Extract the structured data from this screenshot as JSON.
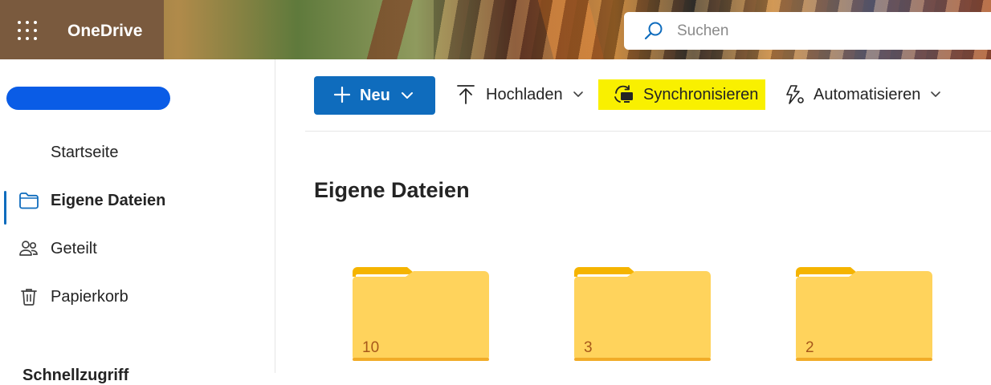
{
  "header": {
    "app_name": "OneDrive",
    "search_placeholder": "Suchen"
  },
  "sidebar": {
    "items": [
      {
        "label": "Startseite",
        "icon": "home-icon",
        "active": false
      },
      {
        "label": "Eigene Dateien",
        "icon": "folder-icon",
        "active": true
      },
      {
        "label": "Geteilt",
        "icon": "people-icon",
        "active": false
      },
      {
        "label": "Papierkorb",
        "icon": "trash-icon",
        "active": false
      }
    ],
    "next_section_partial": "Schnellzugriff"
  },
  "toolbar": {
    "new_label": "Neu",
    "upload_label": "Hochladen",
    "sync_label": "Synchronisieren",
    "automate_label": "Automatisieren"
  },
  "main": {
    "title": "Eigene Dateien",
    "folders": [
      {
        "count": "10"
      },
      {
        "count": "3"
      },
      {
        "count": "2"
      }
    ]
  },
  "colors": {
    "accent": "#0f6cbd",
    "highlight": "#f9f000",
    "folder": "#ffd35c",
    "folder_tab": "#f5b400"
  }
}
